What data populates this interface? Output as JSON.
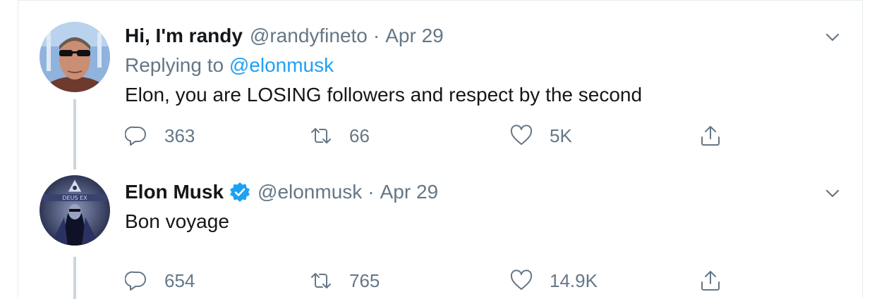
{
  "tweets": [
    {
      "display_name": "Hi, I'm randy",
      "handle": "@randyfineto",
      "separator": "·",
      "date": "Apr 29",
      "replying_prefix": "Replying to",
      "replying_to": "@elonmusk",
      "text": "Elon, you are LOSING followers and respect by the second",
      "verified": false,
      "counts": {
        "reply": "363",
        "retweet": "66",
        "like": "5K"
      }
    },
    {
      "display_name": "Elon Musk",
      "handle": "@elonmusk",
      "separator": "·",
      "date": "Apr 29",
      "text": "Bon voyage",
      "verified": true,
      "counts": {
        "reply": "654",
        "retweet": "765",
        "like": "14.9K"
      }
    }
  ],
  "icons": {
    "reply": "reply-icon",
    "retweet": "retweet-icon",
    "like": "heart-icon",
    "share": "share-icon",
    "more": "chevron-down-icon",
    "verified": "verified-badge-icon"
  },
  "colors": {
    "text": "#14171a",
    "secondary": "#657786",
    "accent": "#1da1f2",
    "thread_line": "#ccd6dd",
    "border": "#e6ecf0"
  }
}
